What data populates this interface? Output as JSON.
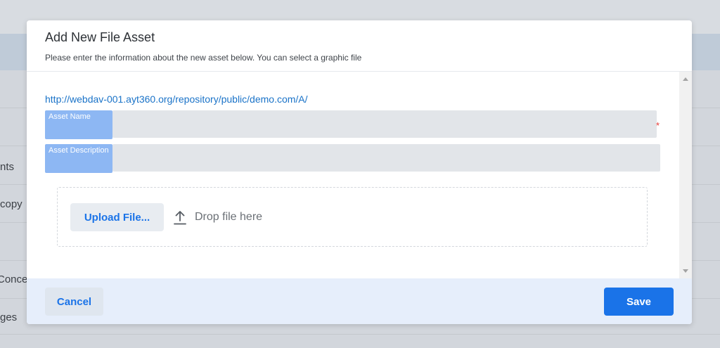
{
  "background": {
    "items": [
      "nts",
      "copy",
      "Conce",
      "ges"
    ]
  },
  "dialog": {
    "title": "Add New File Asset",
    "subtitle": "Please enter the information about the new asset below. You can select a graphic file",
    "repository_url": "http://webdav-001.ayt360.org/repository/public/demo.com/A/",
    "fields": [
      {
        "label": "Asset Name",
        "value": "",
        "required": true,
        "required_marker": "*"
      },
      {
        "label": "Asset Description",
        "value": "",
        "required": false
      }
    ],
    "upload": {
      "button_label": "Upload File...",
      "drop_text": "Drop file here",
      "icon": "upload-icon"
    },
    "footer": {
      "cancel_label": "Cancel",
      "save_label": "Save"
    }
  },
  "colors": {
    "accent": "#1a73e8",
    "label_bg": "#8db7f3",
    "required": "#e53935"
  }
}
